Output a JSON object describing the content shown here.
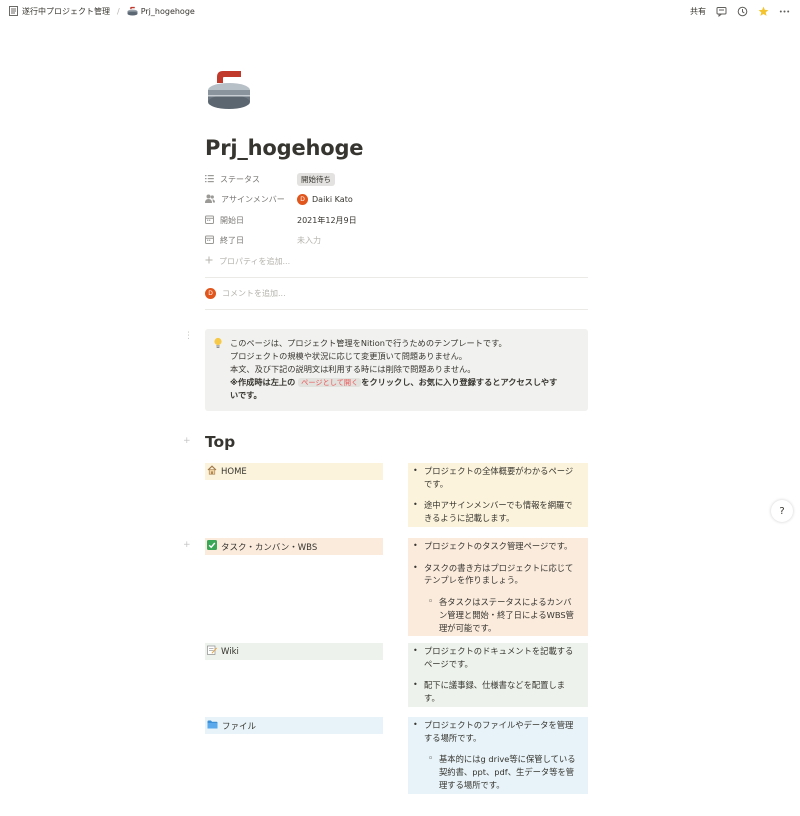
{
  "breadcrumb": {
    "parent": "遂行中プロジェクト管理",
    "separator": "/",
    "current": "Prj_hogehoge"
  },
  "topbar": {
    "share_label": "共有",
    "icons": [
      "comment-icon",
      "history-icon",
      "favorite-star-icon",
      "more-icon"
    ]
  },
  "page": {
    "icon": "curling-stone-icon",
    "title": "Prj_hogehoge"
  },
  "properties": [
    {
      "key": "ステータス",
      "icon": "list-icon",
      "value": "開始待ち",
      "type": "tag"
    },
    {
      "key": "アサインメンバー",
      "icon": "people-icon",
      "value": "Daiki Kato",
      "avatar": "D",
      "type": "person"
    },
    {
      "key": "開始日",
      "icon": "calendar-icon",
      "value": "2021年12月9日",
      "type": "date"
    },
    {
      "key": "終了日",
      "icon": "calendar-icon",
      "value": "未入力",
      "type": "empty"
    }
  ],
  "add_property_label": "プロパティを追加...",
  "comment": {
    "avatar": "D",
    "placeholder": "コメントを追加..."
  },
  "callout": {
    "icon": "lightbulb-icon",
    "line1": "このページは、プロジェクト管理をNitionで行うためのテンプレートです。",
    "line2": "プロジェクトの規模や状況に応じて変更頂いて問題ありません。",
    "line3": "本文、及び下記の説明文は利用する時には削除で問題ありません。",
    "bold_prefix": "※作成時は左上の",
    "inline_code": "ページとして開く",
    "bold_suffix": "をクリックし、お気に入り登録するとアクセスしやす",
    "bold_line2": "いです。"
  },
  "section_heading": "Top",
  "sections": [
    {
      "label": "HOME",
      "icon": "house-icon",
      "color": "#fbf3db",
      "bullets": [
        {
          "lines": [
            "プロジェクトの全体概要がわかるページ",
            "です。"
          ]
        },
        {
          "lines": [
            "途中アサインメンバーでも情報を網羅で",
            "きるように記載します。"
          ]
        }
      ]
    },
    {
      "label": "タスク・カンバン・WBS",
      "icon": "check-icon",
      "color": "#faebdd",
      "bullets": [
        {
          "lines": [
            "プロジェクトのタスク管理ページです。"
          ]
        },
        {
          "lines": [
            "タスクの書き方はプロジェクトに応じて",
            "テンプレを作りましょう。"
          ]
        }
      ],
      "sub_bullets": [
        {
          "lines": [
            "各タスクはステータスによるカンバ",
            "ン管理と開始・終了日によるWBS管",
            "理が可能です。"
          ]
        }
      ]
    },
    {
      "label": "Wiki",
      "icon": "memo-icon",
      "color": "#edf3ec",
      "bullets": [
        {
          "lines": [
            "プロジェクトのドキュメントを記載する",
            "ページです。"
          ]
        },
        {
          "lines": [
            "配下に議事録、仕様書などを配置しま",
            "す。"
          ]
        }
      ]
    },
    {
      "label": "ファイル",
      "icon": "folder-icon",
      "color": "#e7f3f8",
      "bullets": [
        {
          "lines": [
            "プロジェクトのファイルやデータを管理",
            "する場所です。"
          ]
        }
      ],
      "sub_bullets": [
        {
          "lines": [
            "基本的にはg drive等に保管している",
            "契約書、ppt、pdf、生データ等を管",
            "理する場所です。"
          ]
        }
      ]
    }
  ],
  "help_label": "?"
}
